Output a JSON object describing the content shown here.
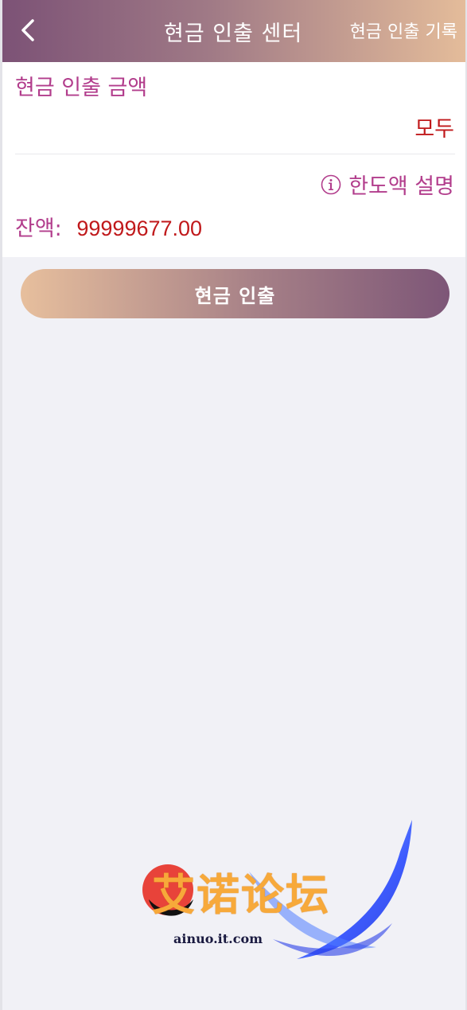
{
  "header": {
    "title": "현금 인출 센터",
    "history_link": "현금 인출 기록"
  },
  "form": {
    "amount_label": "현금 인출 금액",
    "amount_value": "",
    "all_button": "모두",
    "limit_link": "한도액 설명",
    "balance_label": "잔액:",
    "balance_value": "99999677.00"
  },
  "submit_button": "현금 인출",
  "watermark": {
    "text": "艾诺论坛",
    "domain": "ainuo.it.com"
  },
  "colors": {
    "accent_purple": "#7c5276",
    "accent_peach": "#e4bc9a",
    "label_magenta": "#b23d8c",
    "value_red": "#c0191b"
  }
}
